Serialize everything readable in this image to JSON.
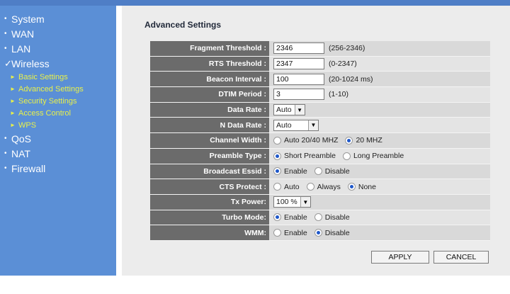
{
  "sidebar": {
    "items": [
      {
        "label": "System",
        "marker": "•"
      },
      {
        "label": "WAN",
        "marker": "•"
      },
      {
        "label": "LAN",
        "marker": "•"
      },
      {
        "label": "Wireless",
        "marker": "✓"
      }
    ],
    "wireless_sub": [
      {
        "label": "Basic Settings"
      },
      {
        "label": "Advanced Settings"
      },
      {
        "label": "Security Settings"
      },
      {
        "label": "Access Control"
      },
      {
        "label": "WPS"
      }
    ],
    "items_after": [
      {
        "label": "QoS",
        "marker": "•"
      },
      {
        "label": "NAT",
        "marker": "•"
      },
      {
        "label": "Firewall",
        "marker": "•"
      }
    ]
  },
  "page": {
    "title": "Advanced Settings"
  },
  "settings": {
    "fragment": {
      "label": "Fragment Threshold :",
      "value": "2346",
      "range": "(256-2346)"
    },
    "rts": {
      "label": "RTS Threshold :",
      "value": "2347",
      "range": "(0-2347)"
    },
    "beacon": {
      "label": "Beacon Interval :",
      "value": "100",
      "range": "(20-1024 ms)"
    },
    "dtim": {
      "label": "DTIM Period :",
      "value": "3",
      "range": "(1-10)"
    },
    "data_rate": {
      "label": "Data Rate :",
      "selected": "Auto"
    },
    "n_data_rate": {
      "label": "N Data Rate :",
      "selected": "Auto"
    },
    "channel_width": {
      "label": "Channel Width :",
      "opt1": "Auto 20/40 MHZ",
      "opt2": "20 MHZ",
      "selected": 2
    },
    "preamble": {
      "label": "Preamble Type :",
      "opt1": "Short Preamble",
      "opt2": "Long Preamble",
      "selected": 1
    },
    "broadcast": {
      "label": "Broadcast Essid :",
      "opt1": "Enable",
      "opt2": "Disable",
      "selected": 1
    },
    "cts": {
      "label": "CTS Protect :",
      "opt1": "Auto",
      "opt2": "Always",
      "opt3": "None",
      "selected": 3
    },
    "tx_power": {
      "label": "Tx Power:",
      "selected": "100 %"
    },
    "turbo": {
      "label": "Turbo Mode:",
      "opt1": "Enable",
      "opt2": "Disable",
      "selected": 1
    },
    "wmm": {
      "label": "WMM:",
      "opt1": "Enable",
      "opt2": "Disable",
      "selected": 2
    }
  },
  "buttons": {
    "apply": "APPLY",
    "cancel": "CANCEL"
  },
  "colors": {
    "sidebar_bg": "#5b8fd6",
    "submenu_text": "#e8f04a",
    "label_bg": "#6b6b6b",
    "radio_selected": "#1e57c9"
  },
  "icons": {
    "bullet": "bullet-icon",
    "check": "checkmark-icon",
    "submenu_arrow": "arrow-right-icon",
    "dropdown": "chevron-down-icon"
  }
}
